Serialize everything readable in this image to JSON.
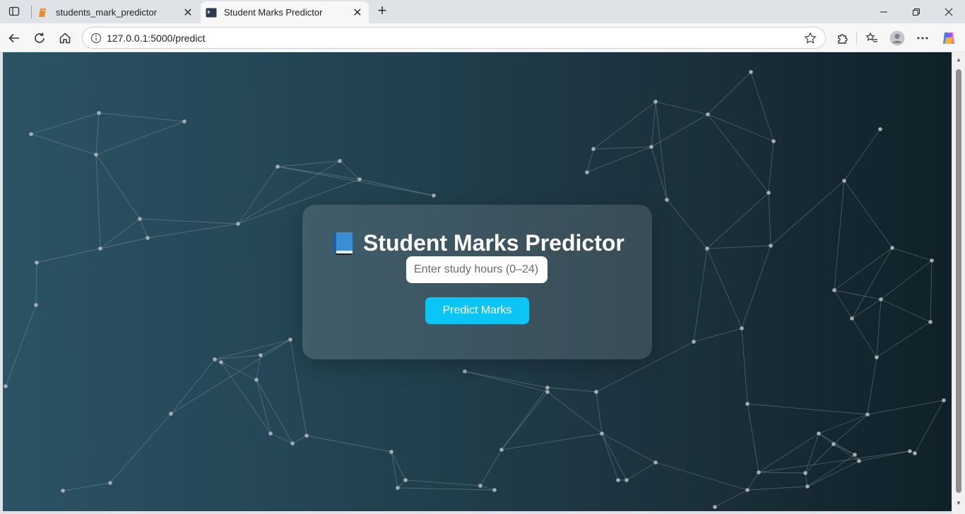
{
  "browser": {
    "tabs": [
      {
        "title": "students_mark_predictor",
        "active": false,
        "icon": "notebook-icon"
      },
      {
        "title": "Student Marks Predictor",
        "active": true,
        "icon": "terminal-icon"
      }
    ],
    "url": "127.0.0.1:5000/predict"
  },
  "page": {
    "title": "Student Marks Predictor",
    "title_icon": "blue-book-emoji",
    "input_placeholder": "Enter study hours (0–24)",
    "input_value": "",
    "button_label": "Predict Marks"
  },
  "colors": {
    "background_left": "#2b5364",
    "background_right": "#0f2028",
    "button": "#0bc6f5",
    "network_node": "#a5adb2"
  }
}
